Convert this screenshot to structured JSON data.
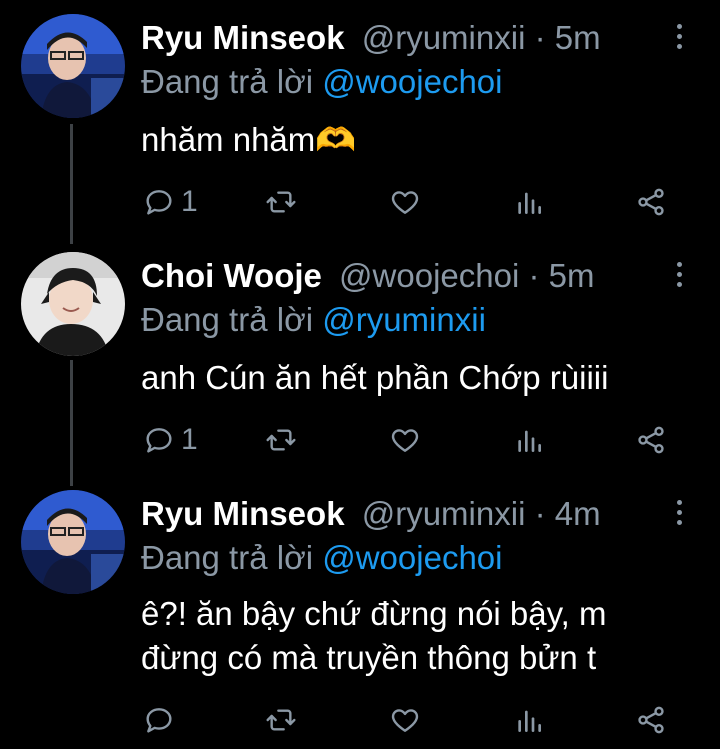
{
  "tweets": [
    {
      "name": "Ryu Minseok",
      "handle": "@ryuminxii",
      "time": "5m",
      "reply_prefix": "Đang trả lời",
      "reply_to": "@woojechoi",
      "text": "nhăm nhăm🫶",
      "reply_count": "1",
      "avatar": "avatar-ryu"
    },
    {
      "name": "Choi Wooje",
      "handle": "@woojechoi",
      "time": "5m",
      "reply_prefix": "Đang trả lời",
      "reply_to": "@ryuminxii",
      "text": "anh Cún ăn hết phần Chớp rùiiii",
      "reply_count": "1",
      "avatar": "avatar-choi"
    },
    {
      "name": "Ryu Minseok",
      "handle": "@ryuminxii",
      "time": "4m",
      "reply_prefix": "Đang trả lời",
      "reply_to": "@woojechoi",
      "text": "ê?! ăn bậy chứ đừng nói bậy, m đừng có mà truyền thông bửn t",
      "reply_count": "",
      "avatar": "avatar-ryu"
    }
  ],
  "icons": {
    "reply": "reply-icon",
    "retweet": "retweet-icon",
    "like": "like-icon",
    "views": "views-icon",
    "share": "share-icon",
    "more": "more-icon"
  },
  "colors": {
    "background": "#000000",
    "secondary_text": "#8b98a5",
    "mention": "#1d9bf0",
    "thread_line": "#3d4145"
  }
}
